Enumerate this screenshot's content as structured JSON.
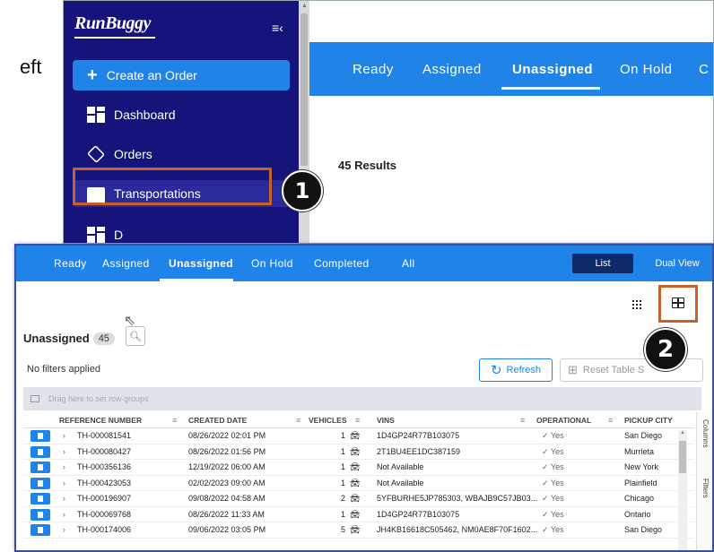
{
  "side_text": "eft",
  "sidebar": {
    "logo": "RunBuggy",
    "create_label": "Create an Order",
    "items": [
      {
        "label": "Dashboard"
      },
      {
        "label": "Orders"
      },
      {
        "label": "Transportations"
      },
      {
        "label": "D"
      }
    ]
  },
  "top": {
    "tabs": [
      "Ready",
      "Assigned",
      "Unassigned",
      "On Hold",
      "C"
    ],
    "active_tab": "Unassigned",
    "results": "45 Results"
  },
  "callouts": [
    "1",
    "2"
  ],
  "zoom": {
    "tabs": [
      "Ready",
      "Assigned",
      "Unassigned",
      "On Hold",
      "Completed",
      "All"
    ],
    "active_tab": "Unassigned",
    "view_list": "List",
    "view_dual": "Dual View",
    "section_title": "Unassigned",
    "count": "45",
    "no_filters": "No filters applied",
    "refresh_label": "Refresh",
    "reset_label": "Reset Table S",
    "group_hint": "Drag here to set row groups",
    "columns_label": "Columns",
    "filters_label": "Filters",
    "headers": [
      "REFERENCE NUMBER",
      "CREATED DATE",
      "VEHICLES",
      "VINS",
      "OPERATIONAL",
      "PICKUP CITY"
    ],
    "rows": [
      {
        "ref": "TH-000081541",
        "date": "08/26/2022 02:01 PM",
        "veh": "1",
        "vins": "1D4GP24R77B103075",
        "op": "Yes",
        "city": "San Diego"
      },
      {
        "ref": "TH-000080427",
        "date": "08/26/2022 01:56 PM",
        "veh": "1",
        "vins": "2T1BU4EE1DC387159",
        "op": "Yes",
        "city": "Murrieta"
      },
      {
        "ref": "TH-000356136",
        "date": "12/19/2022 06:00 AM",
        "veh": "1",
        "vins": "Not Available",
        "op": "Yes",
        "city": "New York"
      },
      {
        "ref": "TH-000423053",
        "date": "02/02/2023 09:00 AM",
        "veh": "1",
        "vins": "Not Available",
        "op": "Yes",
        "city": "Plainfield"
      },
      {
        "ref": "TH-000196907",
        "date": "09/08/2022 04:58 AM",
        "veh": "2",
        "vins": "5YFBURHE5JP785303, WBAJB9C57JB03...",
        "op": "Yes",
        "city": "Chicago"
      },
      {
        "ref": "TH-000069768",
        "date": "08/26/2022 11:33 AM",
        "veh": "1",
        "vins": "1D4GP24R77B103075",
        "op": "Yes",
        "city": "Ontario"
      },
      {
        "ref": "TH-000174006",
        "date": "09/06/2022 03:05 PM",
        "veh": "5",
        "vins": "JH4KB16618C505462, NM0AE8F70F1602...",
        "op": "Yes",
        "city": "San Diego"
      }
    ]
  }
}
